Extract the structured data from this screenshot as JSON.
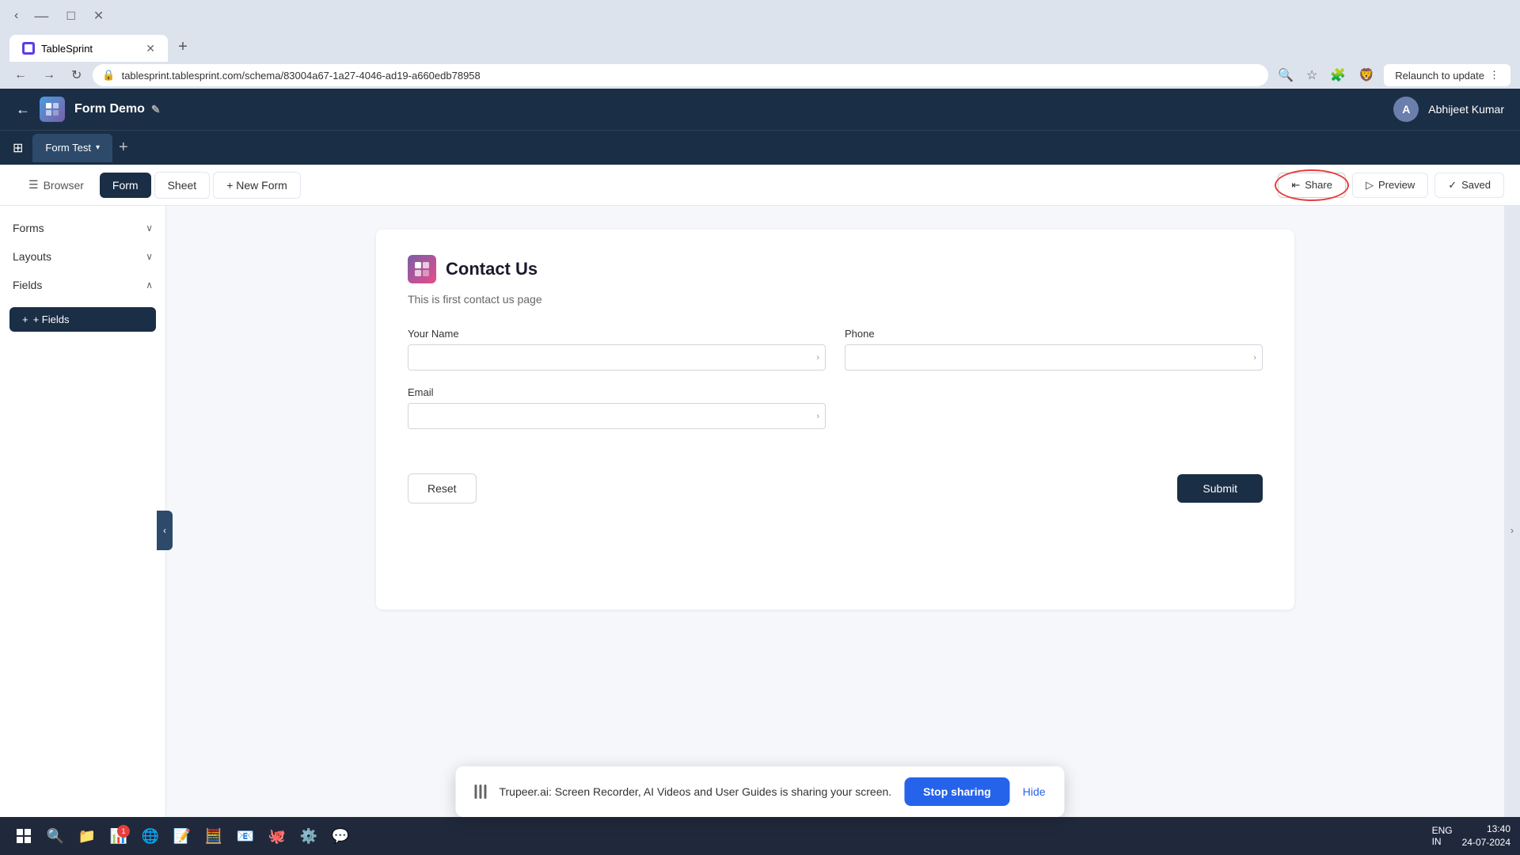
{
  "browser": {
    "url": "tablesprint.tablesprint.com/schema/83004a67-1a27-4046-ad19-a660edb78958",
    "tab_title": "TableSprint",
    "relaunch_label": "Relaunch to update"
  },
  "app": {
    "title": "Form Demo",
    "back_label": "←",
    "user_name": "Abhijeet Kumar",
    "user_initial": "A"
  },
  "workspace": {
    "tab_label": "Form Test",
    "tab_chevron": "▾"
  },
  "sub_header": {
    "browser_label": "Browser",
    "form_label": "Form",
    "sheet_label": "Sheet",
    "new_form_label": "+ New Form",
    "share_label": "Share",
    "preview_label": "Preview",
    "saved_label": "Saved"
  },
  "sidebar": {
    "forms_label": "Forms",
    "layouts_label": "Layouts",
    "fields_label": "Fields",
    "add_fields_label": "+ Fields"
  },
  "form": {
    "title": "Contact Us",
    "description": "This is first contact us page",
    "fields": [
      {
        "label": "Your Name",
        "placeholder": ""
      },
      {
        "label": "Phone",
        "placeholder": ""
      },
      {
        "label": "Email",
        "placeholder": ""
      }
    ],
    "reset_label": "Reset",
    "submit_label": "Submit"
  },
  "banner": {
    "text": "Trupeer.ai: Screen Recorder, AI Videos and User Guides is sharing your screen.",
    "stop_label": "Stop sharing",
    "hide_label": "Hide"
  },
  "taskbar": {
    "time": "13:40",
    "date": "24-07-2024",
    "lang": "ENG",
    "lang_region": "IN"
  }
}
